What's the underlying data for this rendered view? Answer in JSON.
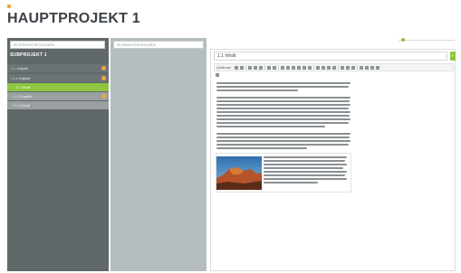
{
  "page": {
    "title": "HAUPTPROJEKT 1"
  },
  "structure": {
    "search_placeholder": "IN STRUKTUR SUCHEN",
    "subproject_title": "SUBPROJEKT 1",
    "tree": [
      {
        "label": "• 1. Kapitel"
      },
      {
        "label": "• 1.1 Kapitel"
      },
      {
        "label": "1.1 Inhalt"
      },
      {
        "label": "• 1.2 Kapitel"
      },
      {
        "label": "• 1.3 Inhalt"
      }
    ]
  },
  "content": {
    "search_placeholder": "IN INHALTEN SUCHEN"
  },
  "editor": {
    "title_value": "1.1 Inhalt",
    "toolbar_source_label": "Quellcode"
  },
  "colors": {
    "accent_green": "#8ec63f",
    "badge_orange": "#f0a640",
    "sidebar_dark": "#5f6769",
    "panel_grey": "#b5bdbe"
  }
}
